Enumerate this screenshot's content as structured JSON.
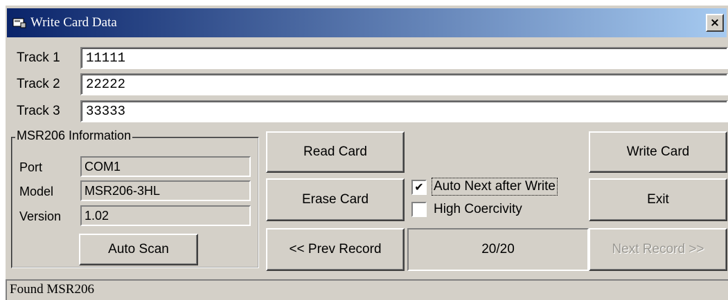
{
  "window": {
    "title": "Write Card Data",
    "close_label": "×",
    "app_icon": "card-reader-icon"
  },
  "tracks": [
    {
      "label": "Track 1",
      "value": "11111"
    },
    {
      "label": "Track 2",
      "value": "22222"
    },
    {
      "label": "Track 3",
      "value": "33333"
    }
  ],
  "info": {
    "legend": "MSR206 Information",
    "port_label": "Port",
    "port_value": "COM1",
    "model_label": "Model",
    "model_value": "MSR206-3HL",
    "version_label": "Version",
    "version_value": "1.02",
    "auto_scan_label": "Auto Scan"
  },
  "buttons": {
    "read_card": "Read Card",
    "erase_card": "Erase Card",
    "prev_record": "<< Prev Record",
    "write_card": "Write Card",
    "exit": "Exit",
    "next_record": "Next Record >>"
  },
  "options": {
    "auto_next_label": "Auto Next after Write",
    "auto_next_checked": true,
    "auto_next_mark": "✔",
    "high_coercivity_label": "High Coercivity",
    "high_coercivity_checked": false
  },
  "record_counter": "20/20",
  "status": "Found MSR206"
}
